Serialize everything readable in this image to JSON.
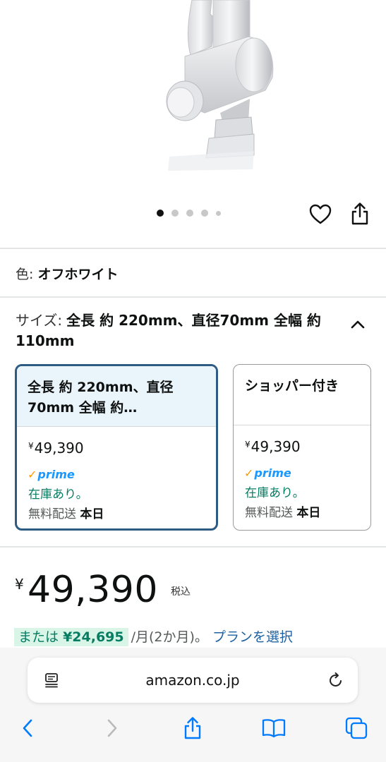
{
  "carousel": {
    "total_dots": 5,
    "active_index": 0
  },
  "product": {
    "color_label": "色:",
    "color_value": "オフホワイト",
    "size_label": "サイズ:",
    "size_value": "全長 約 220mm、直径70mm 全幅 約 110mm"
  },
  "size_options": [
    {
      "title_line1": "全長 約 220mm、直径",
      "title_line2": "70mm 全幅 約…",
      "price_symbol": "¥",
      "price": "49,390",
      "prime_label": "prime",
      "stock": "在庫あり。",
      "shipping_prefix": "無料配送",
      "shipping_day": "本日",
      "selected": true
    },
    {
      "title_line1": "ショッパー付き",
      "title_line2": "",
      "price_symbol": "¥",
      "price": "49,390",
      "prime_label": "prime",
      "stock": "在庫あり。",
      "shipping_prefix": "無料配送",
      "shipping_day": "本日",
      "selected": false
    }
  ],
  "price": {
    "symbol": "¥",
    "amount": "49,390",
    "tax_note": "税込"
  },
  "installment": {
    "prefix": "または",
    "amount": "¥24,695",
    "suffix": "/月(2か月)。",
    "link": "プランを選択"
  },
  "browser": {
    "url": "amazon.co.jp"
  },
  "colors": {
    "selected_border": "#2e5b82",
    "selected_head_bg": "#eaf4fb",
    "stock_green": "#067d62",
    "link_blue": "#2162a1",
    "prime_blue": "#1a98ff",
    "ios_blue": "#007aff"
  }
}
